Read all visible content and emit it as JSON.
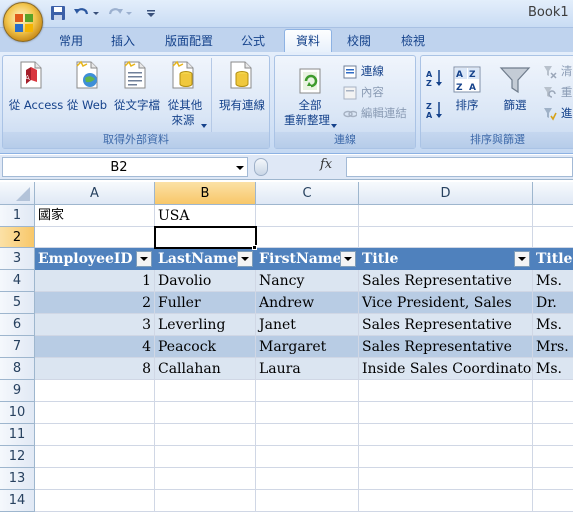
{
  "app": {
    "title": "Book1"
  },
  "tabs": [
    {
      "label": "常用"
    },
    {
      "label": "插入"
    },
    {
      "label": "版面配置"
    },
    {
      "label": "公式"
    },
    {
      "label": "資料",
      "active": true
    },
    {
      "label": "校閱"
    },
    {
      "label": "檢視"
    }
  ],
  "ribbon": {
    "external": {
      "label": "取得外部資料",
      "from_access": "從 Access",
      "from_web": "從 Web",
      "from_text": "從文字檔",
      "from_other_1": "從其他",
      "from_other_2": "來源",
      "existing_1": "現有連線"
    },
    "connections": {
      "label": "連線",
      "refresh_1": "全部",
      "refresh_2": "重新整理",
      "connections": "連線",
      "properties": "內容",
      "edit_links": "編輯連結"
    },
    "sort_filter": {
      "label": "排序與篩選",
      "sort": "排序",
      "filter": "篩選",
      "clear": "清",
      "reapply": "重",
      "advanced": "進"
    }
  },
  "formula_bar": {
    "name_box": "B2",
    "fx": "fx",
    "formula": ""
  },
  "columns": [
    "A",
    "B",
    "C",
    "D",
    ""
  ],
  "rows": [
    "1",
    "2",
    "3",
    "4",
    "5",
    "6",
    "7",
    "8",
    "9",
    "10",
    "11",
    "12",
    "13",
    "14"
  ],
  "cells": {
    "a1": "國家",
    "b1": "USA",
    "table_headers": [
      "EmployeeID",
      "LastName",
      "FirstName",
      "Title",
      "TitleOfCourtesy"
    ],
    "table_rows": [
      [
        "1",
        "Davolio",
        "Nancy",
        "Sales Representative",
        "Ms."
      ],
      [
        "2",
        "Fuller",
        "Andrew",
        "Vice President, Sales",
        "Dr."
      ],
      [
        "3",
        "Leverling",
        "Janet",
        "Sales Representative",
        "Ms."
      ],
      [
        "4",
        "Peacock",
        "Margaret",
        "Sales Representative",
        "Mrs."
      ],
      [
        "8",
        "Callahan",
        "Laura",
        "Inside Sales Coordinator",
        "Ms."
      ]
    ]
  },
  "colors": {
    "table_header": "#4f81bd",
    "band_light": "#dbe5f1",
    "band_dark": "#b8cce4",
    "selected_header": "#f8c769"
  }
}
